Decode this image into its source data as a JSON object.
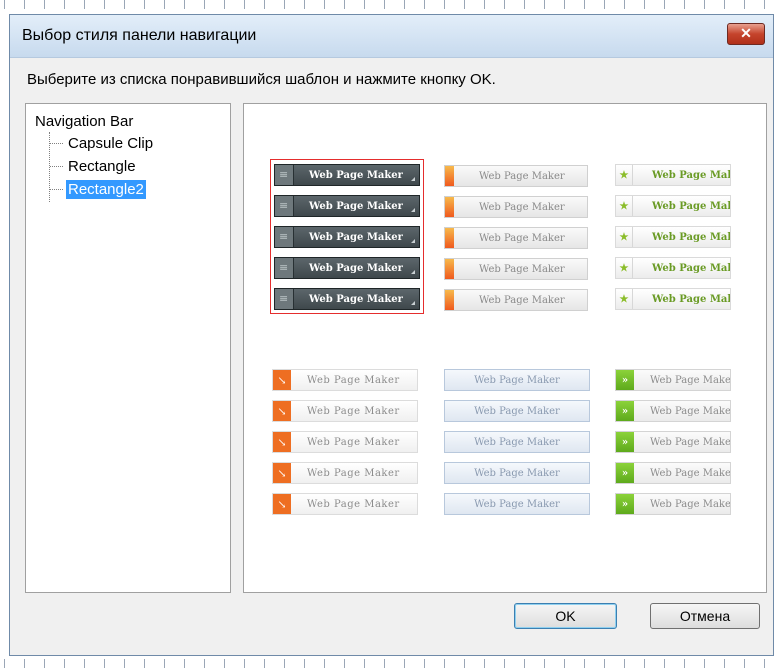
{
  "dialog": {
    "title": "Выбор стиля панели навигации",
    "close_label": "✕",
    "instruction": "Выберите из списка понравившийся шаблон и нажмите кнопку OK."
  },
  "tree": {
    "root": "Navigation Bar",
    "items": [
      "Capsule Clip",
      "Rectangle",
      "Rectangle2"
    ],
    "selected": "Rectangle2"
  },
  "preview": {
    "button_text": "Web Page Maker",
    "spaced_button_text": "Web  Page Maker",
    "buttons_per_style": 5,
    "selected_style": "dark",
    "styles": [
      "dark",
      "orange-bar",
      "star",
      "orange-arrow",
      "blue",
      "green-arrow"
    ]
  },
  "icons": {
    "dark": "menu-lines-icon",
    "orange": "orange-bar-icon",
    "star": "star-icon",
    "arrow": "arrow-down-right-icon",
    "green": "double-chevron-icon",
    "close": "close-icon"
  },
  "buttons": {
    "ok": "OK",
    "cancel": "Отмена"
  },
  "colors": {
    "selection": "#3399ff",
    "selected_frame": "#e52d2d",
    "close_button": "#c5442c",
    "orange_accent": "#ee6e22",
    "green_accent": "#6ab42a"
  }
}
